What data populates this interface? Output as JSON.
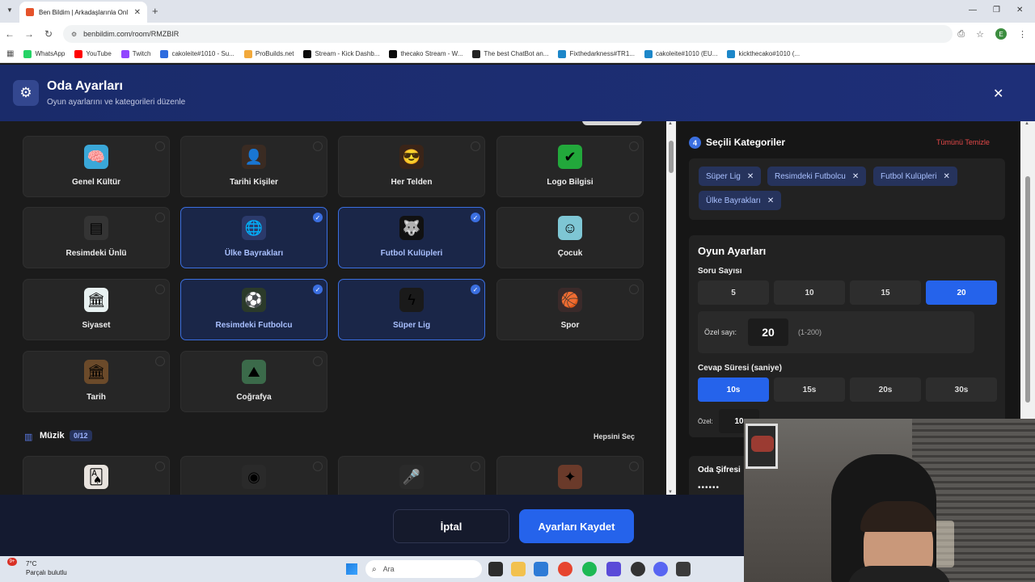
{
  "browser": {
    "tab_title": "Ben Bildim | Arkadaşlarınla Onl",
    "url": "benbildim.com/room/RMZBIR",
    "bookmarks": [
      {
        "label": "WhatsApp",
        "color": "#25d366"
      },
      {
        "label": "YouTube",
        "color": "#ff0000"
      },
      {
        "label": "Twitch",
        "color": "#9146ff"
      },
      {
        "label": "cakoleite#1010 - Su...",
        "color": "#2d6cdf"
      },
      {
        "label": "ProBuilds.net",
        "color": "#f2a93b"
      },
      {
        "label": "Stream - Kick Dashb...",
        "color": "#0b0b0b"
      },
      {
        "label": "thecako Stream - W...",
        "color": "#0b0b0b"
      },
      {
        "label": "The best ChatBot an...",
        "color": "#222222"
      },
      {
        "label": "Fixthedarkness#TR1...",
        "color": "#1d87c9"
      },
      {
        "label": "cakoleite#1010 (EU...",
        "color": "#1d87c9"
      },
      {
        "label": "kickthecako#1010 (...",
        "color": "#1d87c9"
      }
    ]
  },
  "modal": {
    "title": "Oda Ayarları",
    "subtitle": "Oyun ayarlarını ve kategorileri düzenle"
  },
  "categories": [
    {
      "name": "Genel Kültür",
      "selected": false,
      "icon": "globe-brain-icon",
      "bg": "#3aa7d8",
      "glyph": "🧠"
    },
    {
      "name": "Tarihi Kişiler",
      "selected": false,
      "icon": "historic-portrait-icon",
      "bg": "#3a2b22",
      "glyph": "👤"
    },
    {
      "name": "Her Telden",
      "selected": false,
      "icon": "sunglasses-face-icon",
      "bg": "#3a2418",
      "glyph": "😎"
    },
    {
      "name": "Logo Bilgisi",
      "selected": false,
      "icon": "logo-card-icon",
      "bg": "#22a83b",
      "glyph": "✔"
    },
    {
      "name": "Resimdeki Ünlü",
      "selected": false,
      "icon": "document-icon",
      "bg": "#343434",
      "glyph": "▤"
    },
    {
      "name": "Ülke Bayrakları",
      "selected": true,
      "icon": "flag-globe-icon",
      "bg": "#2b3a6b",
      "glyph": "🌐"
    },
    {
      "name": "Futbol Kulüpleri",
      "selected": true,
      "icon": "wolf-crest-icon",
      "bg": "#111111",
      "glyph": "🐺"
    },
    {
      "name": "Çocuk",
      "selected": false,
      "icon": "child-face-icon",
      "bg": "#7ec6d4",
      "glyph": "☺"
    },
    {
      "name": "Siyaset",
      "selected": false,
      "icon": "parliament-icon",
      "bg": "#e8f1f1",
      "glyph": "🏛"
    },
    {
      "name": "Resimdeki Futbolcu",
      "selected": true,
      "icon": "footballer-icon",
      "bg": "#2b3a2a",
      "glyph": "⚽"
    },
    {
      "name": "Süper Lig",
      "selected": true,
      "icon": "league-logo-icon",
      "bg": "#1a1a1a",
      "glyph": "ϟ"
    },
    {
      "name": "Spor",
      "selected": false,
      "icon": "sports-balls-icon",
      "bg": "#3a2a2a",
      "glyph": "🏀"
    },
    {
      "name": "Tarih",
      "selected": false,
      "icon": "colosseum-icon",
      "bg": "#6b4a2a",
      "glyph": "🏛"
    },
    {
      "name": "Coğrafya",
      "selected": false,
      "icon": "mountain-map-icon",
      "bg": "#3b6a4a",
      "glyph": "⛰"
    }
  ],
  "music": {
    "title": "Müzik",
    "count": "0/12",
    "select_all": "Hepsini Seç",
    "items": [
      {
        "icon": "playing-cards-icon",
        "bg": "#e8e3de",
        "glyph": "🂡"
      },
      {
        "icon": "vinyl-disc-icon",
        "bg": "#2a2a2a",
        "glyph": "◉"
      },
      {
        "icon": "microphone-icon",
        "bg": "#2a2a2a",
        "glyph": "🎤"
      },
      {
        "icon": "ornament-icon",
        "bg": "#6a3a2a",
        "glyph": "✦"
      }
    ]
  },
  "selected_panel": {
    "count": "4",
    "title": "Seçili Kategoriler",
    "clear_all": "Tümünü Temizle",
    "chips": [
      "Süper Lig",
      "Resimdeki Futbolcu",
      "Futbol Kulüpleri",
      "Ülke Bayrakları"
    ]
  },
  "game_settings": {
    "title": "Oyun Ayarları",
    "question_count_label": "Soru Sayısı",
    "question_options": [
      "5",
      "10",
      "15",
      "20"
    ],
    "question_selected": "20",
    "custom_count_label": "Özel sayı:",
    "custom_count_value": "20",
    "custom_count_range": "(1-200)",
    "answer_time_label": "Cevap Süresi (saniye)",
    "time_options": [
      "10s",
      "15s",
      "20s",
      "30s"
    ],
    "time_selected": "10s",
    "custom_time_label": "Özel:",
    "custom_time_value": "10",
    "room_password_label": "Oda Şifresi",
    "room_password_value": "••••••"
  },
  "footer": {
    "cancel": "İptal",
    "save": "Ayarları Kaydet"
  },
  "taskbar": {
    "temperature": "7°C",
    "weather": "Parçalı bulutlu",
    "notification_count": "9+",
    "search_placeholder": "Ara"
  }
}
